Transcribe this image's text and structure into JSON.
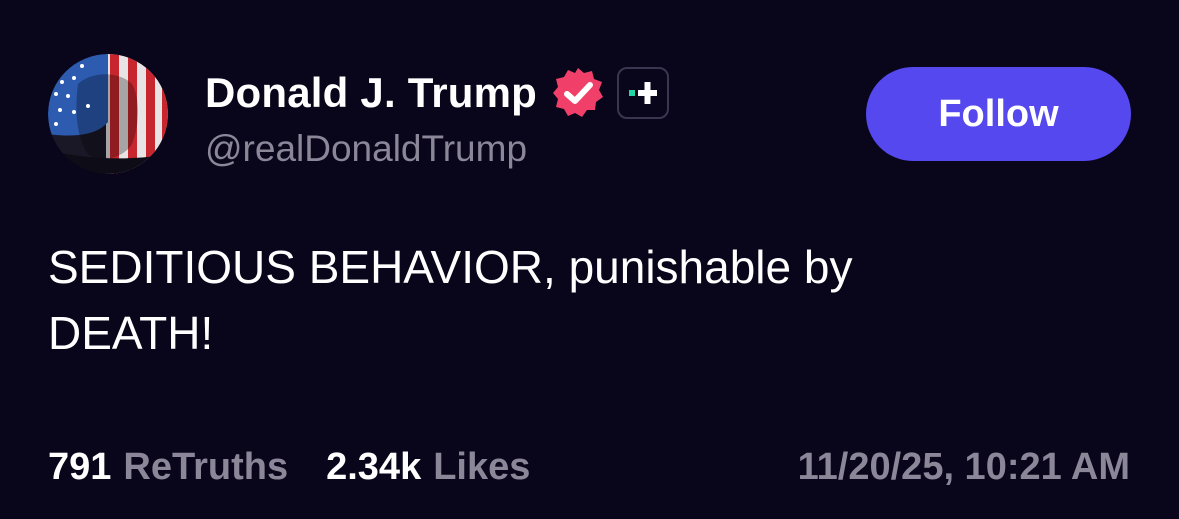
{
  "author": {
    "display_name": "Donald J. Trump",
    "handle": "@realDonaldTrump",
    "verified_icon": "verified-badge-icon",
    "plus_icon": "plus-badge-icon"
  },
  "follow_label": "Follow",
  "post": {
    "lines": [
      "SEDITIOUS BEHAVIOR, punishable by",
      "DEATH!"
    ]
  },
  "stats": {
    "retruths_count": "791",
    "retruths_label": "ReTruths",
    "likes_count": "2.34k",
    "likes_label": "Likes"
  },
  "timestamp": "11/20/25, 10:21 AM",
  "colors": {
    "background": "#09051a",
    "accent": "#5448ee",
    "verified": "#f0406a",
    "secondary_text": "#8b8799",
    "plus_green": "#23d5a6"
  }
}
